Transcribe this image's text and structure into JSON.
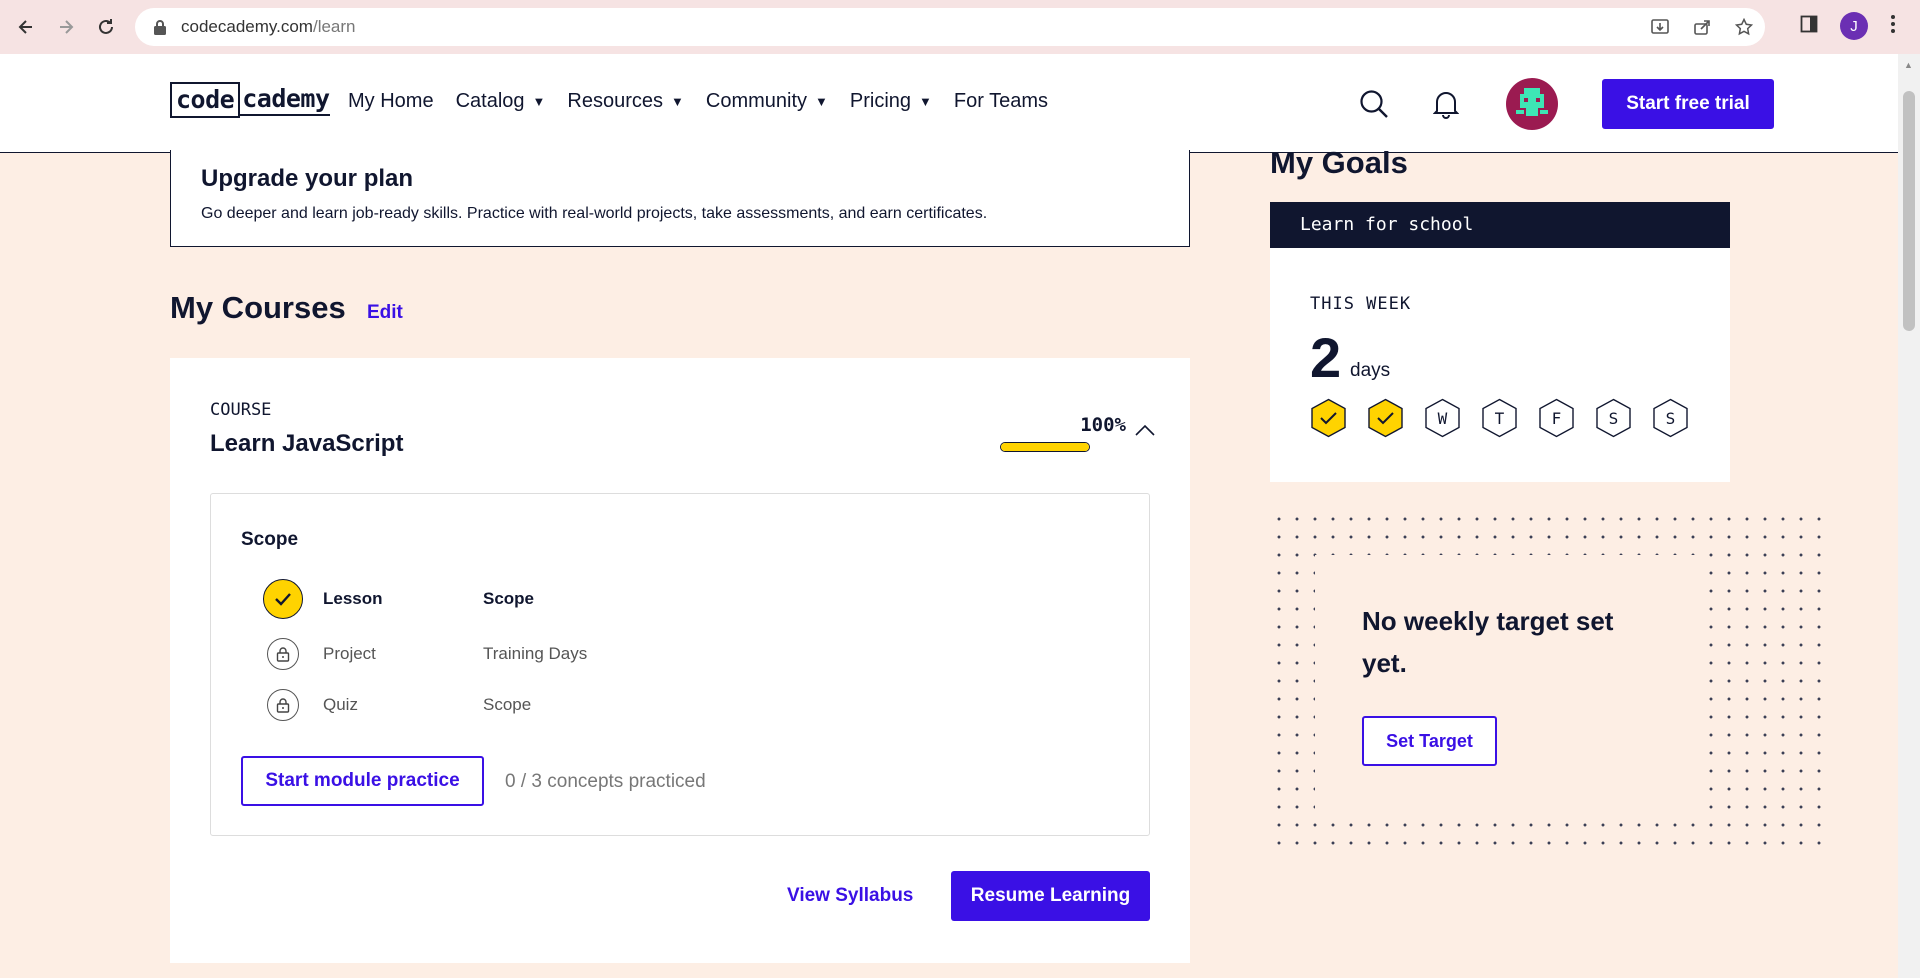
{
  "browser": {
    "url_domain": "codecademy.com",
    "url_path": "/learn",
    "profile_initial": "J"
  },
  "header": {
    "logo": {
      "part1": "code",
      "part2": "cademy"
    },
    "nav": [
      {
        "label": "My Home",
        "has_caret": false
      },
      {
        "label": "Catalog",
        "has_caret": true
      },
      {
        "label": "Resources",
        "has_caret": true
      },
      {
        "label": "Community",
        "has_caret": true
      },
      {
        "label": "Pricing",
        "has_caret": true
      },
      {
        "label": "For Teams",
        "has_caret": false
      }
    ],
    "caret": "▼",
    "trial_button": "Start free trial"
  },
  "upgrade": {
    "title": "Upgrade your plan",
    "description": "Go deeper and learn job-ready skills. Practice with real-world projects, take assessments, and earn certificates."
  },
  "courses": {
    "title": "My Courses",
    "edit_label": "Edit",
    "course": {
      "kicker": "COURSE",
      "name": "Learn JavaScript",
      "progress_label": "100%",
      "progress": 1.0,
      "module": {
        "title": "Scope",
        "items": [
          {
            "type": "Lesson",
            "name": "Scope",
            "status": "done"
          },
          {
            "type": "Project",
            "name": "Training Days",
            "status": "locked"
          },
          {
            "type": "Quiz",
            "name": "Scope",
            "status": "locked"
          }
        ],
        "practice_button": "Start module practice",
        "concepts": "0 / 3 concepts practiced"
      },
      "syllabus_link": "View Syllabus",
      "resume_button": "Resume Learning"
    }
  },
  "goals": {
    "title": "My Goals",
    "goal_name": "Learn for school",
    "week_label": "THIS WEEK",
    "days_count": "2",
    "days_unit": "days",
    "week_days": [
      {
        "label": "",
        "done": true
      },
      {
        "label": "",
        "done": true
      },
      {
        "label": "W",
        "done": false
      },
      {
        "label": "T",
        "done": false
      },
      {
        "label": "F",
        "done": false
      },
      {
        "label": "S",
        "done": false
      },
      {
        "label": "S",
        "done": false
      }
    ],
    "no_target_text": "No weekly target set yet.",
    "set_target_button": "Set Target"
  },
  "colors": {
    "brand": "#3a10e5",
    "navy": "#10162f",
    "yellow": "#ffd300",
    "page_bg": "#fdeee4"
  }
}
